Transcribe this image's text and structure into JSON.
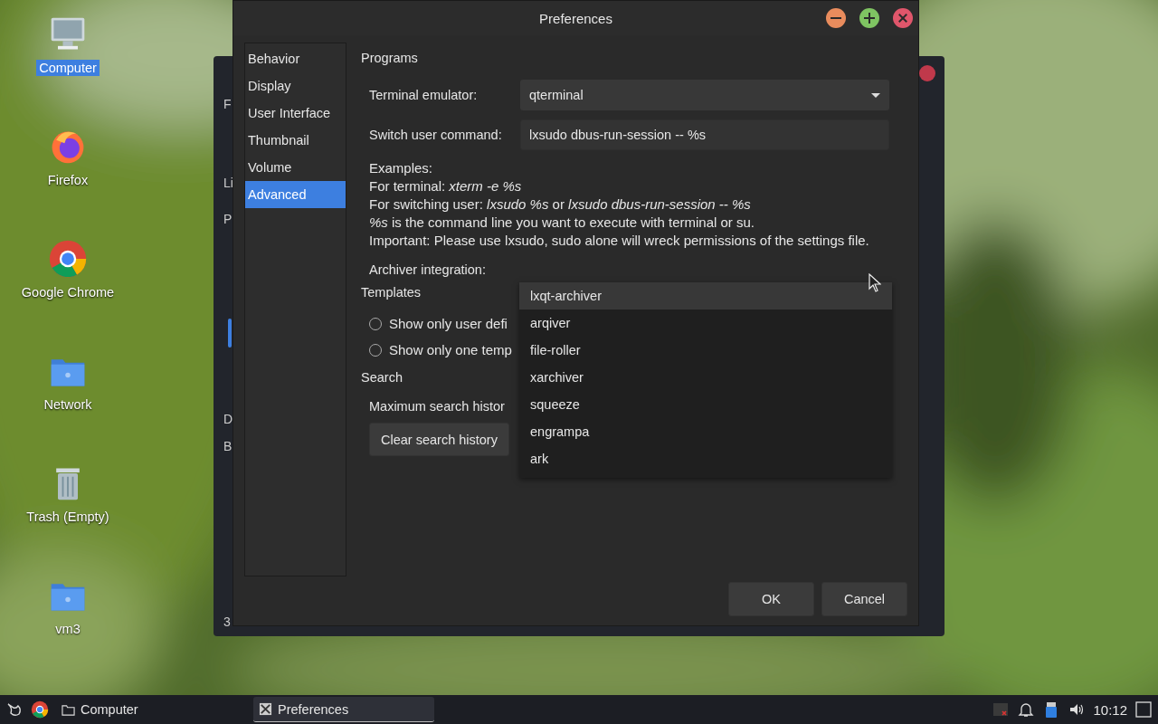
{
  "desktop_icons": [
    {
      "label": "Computer",
      "kind": "computer",
      "selected": true
    },
    {
      "label": "Firefox",
      "kind": "firefox",
      "selected": false
    },
    {
      "label": "Google Chrome",
      "kind": "chrome",
      "selected": false
    },
    {
      "label": "Network",
      "kind": "network",
      "selected": false
    },
    {
      "label": "Trash (Empty)",
      "kind": "trash",
      "selected": false
    },
    {
      "label": "vm3",
      "kind": "home",
      "selected": false
    }
  ],
  "background_window": {
    "fragments": [
      "F",
      "Li",
      "P",
      "D",
      "B",
      "3"
    ]
  },
  "dialog": {
    "title": "Preferences",
    "sidebar": {
      "items": [
        {
          "label": "Behavior",
          "selected": false
        },
        {
          "label": "Display",
          "selected": false
        },
        {
          "label": "User Interface",
          "selected": false
        },
        {
          "label": "Thumbnail",
          "selected": false
        },
        {
          "label": "Volume",
          "selected": false
        },
        {
          "label": "Advanced",
          "selected": true
        }
      ]
    },
    "programs": {
      "heading": "Programs",
      "terminal_emulator": {
        "label": "Terminal emulator:",
        "value": "qterminal"
      },
      "switch_user_command": {
        "label": "Switch user command:",
        "value": "lxsudo dbus-run-session -- %s"
      },
      "examples": [
        "Examples:",
        "For terminal: *xterm -e %s*",
        "For switching user: *lxsudo %s* or *lxsudo dbus-run-session -- %s*",
        "*%s* is the command line you want to execute with terminal or su.",
        "Important: Please use lxsudo, sudo alone will wreck permissions of the settings file."
      ],
      "archiver_integration": {
        "label": "Archiver integration:",
        "options": [
          {
            "label": "lxqt-archiver",
            "selected": true
          },
          {
            "label": "arqiver",
            "selected": false
          },
          {
            "label": "file-roller",
            "selected": false
          },
          {
            "label": "xarchiver",
            "selected": false
          },
          {
            "label": "squeeze",
            "selected": false
          },
          {
            "label": "engrampa",
            "selected": false
          },
          {
            "label": "ark",
            "selected": false
          }
        ]
      }
    },
    "templates": {
      "heading": "Templates",
      "options": [
        {
          "label": "Show only user defi",
          "checked": false
        },
        {
          "label": "Show only one temp",
          "checked": false
        }
      ]
    },
    "search": {
      "heading": "Search",
      "max_history_label": "Maximum search histor",
      "clear_button": "Clear search history"
    },
    "buttons": [
      "OK",
      "Cancel"
    ]
  },
  "taskbar": {
    "tasks": [
      {
        "label": "Computer",
        "kind": "folder",
        "selected": false
      },
      {
        "label": "Preferences",
        "kind": "app",
        "selected": true
      }
    ],
    "clock": "10:12"
  }
}
